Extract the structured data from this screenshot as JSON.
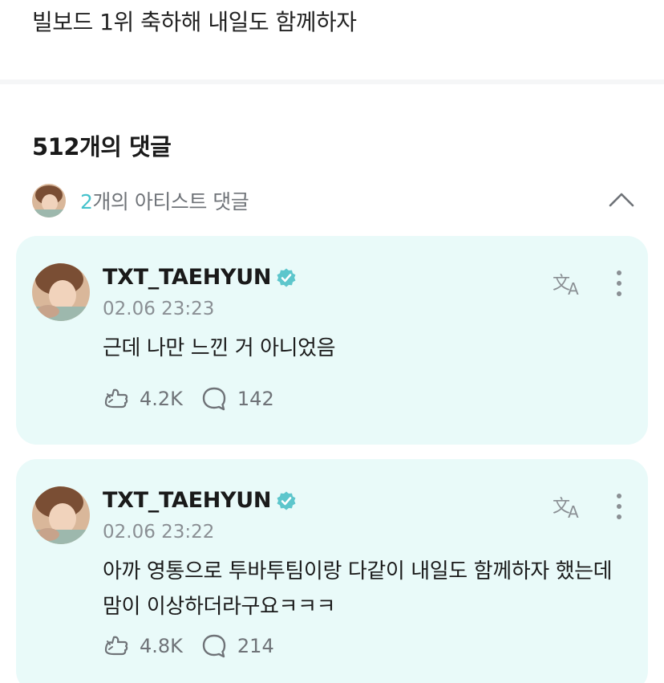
{
  "post": {
    "text": "빌보드 1위 축하해 내일도 함께하자"
  },
  "comments_header": {
    "count_label": "512개의 댓글"
  },
  "artist_comments": {
    "count": "2",
    "label_suffix": "개의 아티스트 댓글"
  },
  "colors": {
    "card_bg": "#e9faf9",
    "accent": "#45c2cc",
    "verified": "#5dc6cc",
    "muted": "#8a8f94"
  },
  "comments": [
    {
      "author": "TXT_TAEHYUN",
      "timestamp": "02.06 23:23",
      "text": "근데 나만 느낀 거 아니었음",
      "likes": "4.2K",
      "replies": "142"
    },
    {
      "author": "TXT_TAEHYUN",
      "timestamp": "02.06 23:22",
      "text": "아까 영통으로 투바투팀이랑 다같이 내일도 함께하자 했는데 맘이 이상하더라구요ㅋㅋㅋ",
      "likes": "4.8K",
      "replies": "214"
    }
  ]
}
